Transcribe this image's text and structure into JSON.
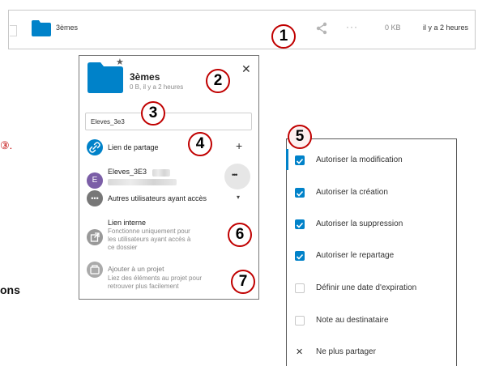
{
  "file_row": {
    "name": "3èmes",
    "more": "···",
    "size": "0 KB",
    "modified": "il y a 2 heures"
  },
  "callouts": [
    "1",
    "2",
    "3",
    "4",
    "5",
    "6",
    "7"
  ],
  "share_panel": {
    "title": "3èmes",
    "meta": "0 B, il y a 2 heures",
    "close": "✕",
    "search_value": "Eleves_3e3",
    "share_link": {
      "label": "Lien de partage",
      "add": "+"
    },
    "group_share": {
      "avatar_letter": "E",
      "name": "Eleves_3E3",
      "more": "•••"
    },
    "others": {
      "label": "Autres utilisateurs ayant accès",
      "caret": "▾"
    },
    "internal_link": {
      "label": "Lien interne",
      "desc": [
        "Fonctionne uniquement pour",
        "les utilisateurs ayant accès à",
        "ce dossier"
      ]
    },
    "project": {
      "label": "Ajouter à un projet",
      "desc": [
        "Liez des éléments au projet pour",
        "retrouver plus facilement"
      ]
    }
  },
  "permissions_menu": {
    "items": [
      {
        "label": "Autoriser la modification",
        "checked": true
      },
      {
        "label": "Autoriser la création",
        "checked": true
      },
      {
        "label": "Autoriser la suppression",
        "checked": true
      },
      {
        "label": "Autoriser le repartage",
        "checked": true
      },
      {
        "label": "Définir une date d'expiration",
        "checked": false
      },
      {
        "label": "Note au destinataire",
        "checked": false
      }
    ],
    "unshare": {
      "icon": "✕",
      "label": "Ne plus partager"
    }
  },
  "cut_off_text": {
    "marker": "③.",
    "bold_fragment": "ons"
  },
  "colors": {
    "accent": "#0082c9",
    "callout_border": "#c00000",
    "purple_avatar": "#7b5ea7"
  }
}
